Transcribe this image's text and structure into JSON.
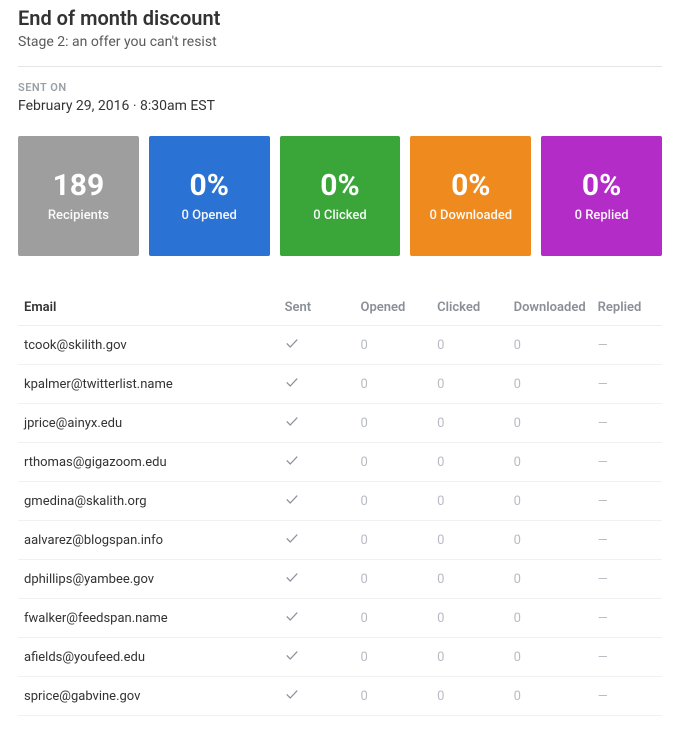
{
  "header": {
    "title": "End of month discount",
    "subtitle": "Stage 2: an offer you can't resist"
  },
  "sent_on": {
    "label": "SENT ON",
    "value": "February 29, 2016 · 8:30am EST"
  },
  "stats": {
    "recipients": {
      "value": "189",
      "label": "Recipients"
    },
    "opened": {
      "value": "0%",
      "label": "0 Opened"
    },
    "clicked": {
      "value": "0%",
      "label": "0 Clicked"
    },
    "downloaded": {
      "value": "0%",
      "label": "0 Downloaded"
    },
    "replied": {
      "value": "0%",
      "label": "0 Replied"
    }
  },
  "table": {
    "headers": {
      "email": "Email",
      "sent": "Sent",
      "opened": "Opened",
      "clicked": "Clicked",
      "downloaded": "Downloaded",
      "replied": "Replied"
    },
    "rows": [
      {
        "email": "tcook@skilith.gov",
        "sent": true,
        "opened": "0",
        "clicked": "0",
        "downloaded": "0",
        "replied": "—"
      },
      {
        "email": "kpalmer@twitterlist.name",
        "sent": true,
        "opened": "0",
        "clicked": "0",
        "downloaded": "0",
        "replied": "—"
      },
      {
        "email": "jprice@ainyx.edu",
        "sent": true,
        "opened": "0",
        "clicked": "0",
        "downloaded": "0",
        "replied": "—"
      },
      {
        "email": "rthomas@gigazoom.edu",
        "sent": true,
        "opened": "0",
        "clicked": "0",
        "downloaded": "0",
        "replied": "—"
      },
      {
        "email": "gmedina@skalith.org",
        "sent": true,
        "opened": "0",
        "clicked": "0",
        "downloaded": "0",
        "replied": "—"
      },
      {
        "email": "aalvarez@blogspan.info",
        "sent": true,
        "opened": "0",
        "clicked": "0",
        "downloaded": "0",
        "replied": "—"
      },
      {
        "email": "dphillips@yambee.gov",
        "sent": true,
        "opened": "0",
        "clicked": "0",
        "downloaded": "0",
        "replied": "—"
      },
      {
        "email": "fwalker@feedspan.name",
        "sent": true,
        "opened": "0",
        "clicked": "0",
        "downloaded": "0",
        "replied": "—"
      },
      {
        "email": "afields@youfeed.edu",
        "sent": true,
        "opened": "0",
        "clicked": "0",
        "downloaded": "0",
        "replied": "—"
      },
      {
        "email": "sprice@gabvine.gov",
        "sent": true,
        "opened": "0",
        "clicked": "0",
        "downloaded": "0",
        "replied": "—"
      }
    ]
  }
}
